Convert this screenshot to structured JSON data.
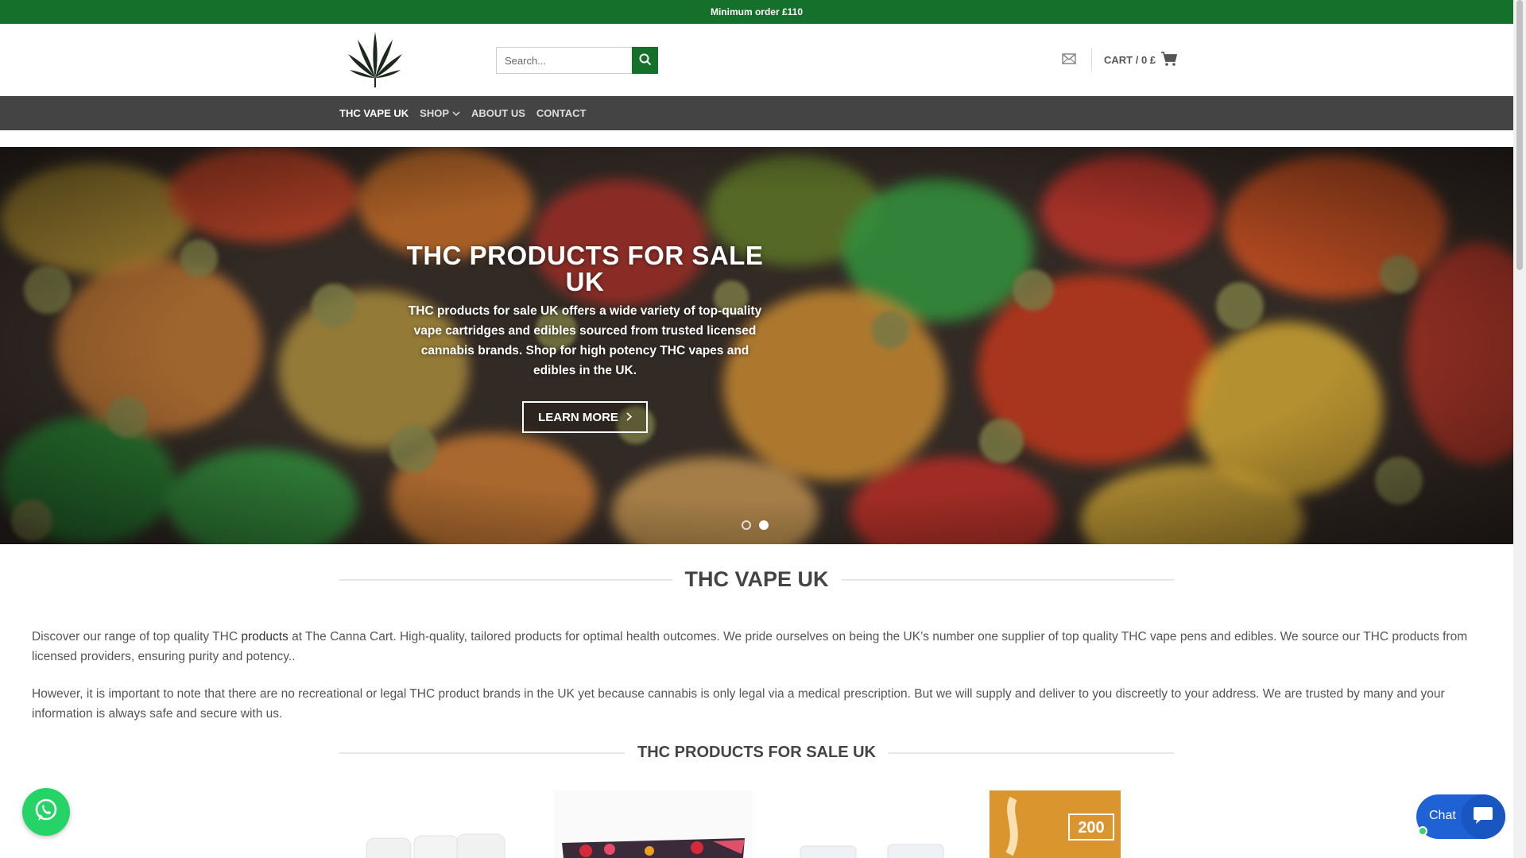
{
  "topbar": {
    "text": "Minimum order £110"
  },
  "header": {
    "search_placeholder": "Search...",
    "cart_label": "CART / 0 £"
  },
  "nav": {
    "items": [
      {
        "label": "THC VAPE UK"
      },
      {
        "label": "SHOP"
      },
      {
        "label": "ABOUT US"
      },
      {
        "label": "CONTACT"
      }
    ]
  },
  "hero": {
    "title": "THC PRODUCTS FOR SALE UK",
    "description": "THC products for sale UK offers a wide variety of top-quality vape cartridges and edibles sourced from trusted licensed cannabis brands. Shop for high potency THC vapes and edibles in the UK.",
    "button_label": "LEARN MORE",
    "slides_total": 2,
    "active_slide": 2
  },
  "section1": {
    "title": "THC VAPE UK",
    "para1_pre": "Discover our range of top quality THC ",
    "para1_link": "products",
    "para1_post": " at The Canna Cart. High-quality, tailored products for optimal health outcomes. We pride ourselves on being the UK’s number one supplier of top quality THC vape pens and edibles. We source our THC products from licensed providers, ensuring purity and potency..",
    "para2": "However, it is important to note that there are no recreational or legal THC product brands in the UK yet because cannabis is only legal via a medical prescription. But we will supply and deliver to you discreetly to your address. We are trusted by many and your information is always safe and secure with us."
  },
  "section2": {
    "title": "THC PRODUCTS FOR SALE UK"
  },
  "products_badge": "200",
  "chat": {
    "label": "Chat"
  },
  "colors": {
    "brand_green": "#14702a",
    "nav_bg": "#444444",
    "chat_blue": "#1e62d6",
    "whatsapp": "#25d366"
  }
}
